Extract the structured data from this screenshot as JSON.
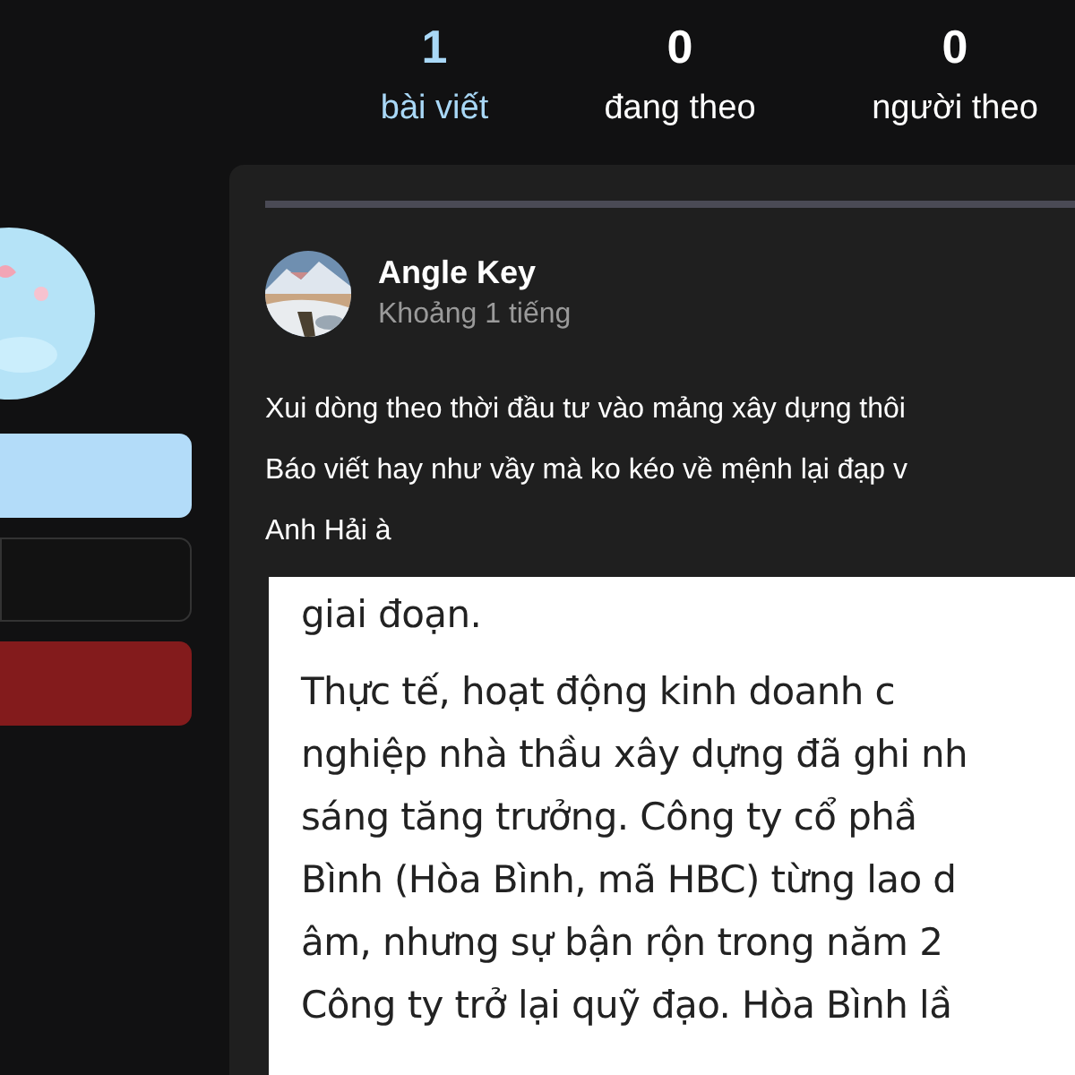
{
  "profile": {
    "buttons": [
      {
        "kind": "primary"
      },
      {
        "kind": "outline"
      },
      {
        "kind": "danger"
      }
    ]
  },
  "stats": [
    {
      "count": "1",
      "label": "bài viết",
      "selected": true
    },
    {
      "count": "0",
      "label": "đang theo",
      "selected": false
    },
    {
      "count": "0",
      "label": "người theo",
      "selected": false
    }
  ],
  "post": {
    "author": "Angle Key",
    "time": "Khoảng 1 tiếng",
    "text_lines": [
      "Xui dòng theo thời đầu tư vào mảng xây dựng thôi",
      "Báo viết hay như vầy mà ko kéo về mệnh lại đạp v",
      "Anh Hải à"
    ],
    "attachment": {
      "paragraphs": [
        [
          "giai đoạn."
        ],
        [
          "Thực tế, hoạt động kinh doanh c",
          "nghiệp nhà thầu xây dựng đã ghi nh",
          "sáng tăng trưởng. Công ty cổ phầ",
          "Bình (Hòa Bình, mã HBC) từng lao d",
          "âm, nhưng sự bận rộn trong năm 2",
          "Công ty trở lại quỹ đạo. Hòa Bình lầ"
        ]
      ]
    }
  }
}
